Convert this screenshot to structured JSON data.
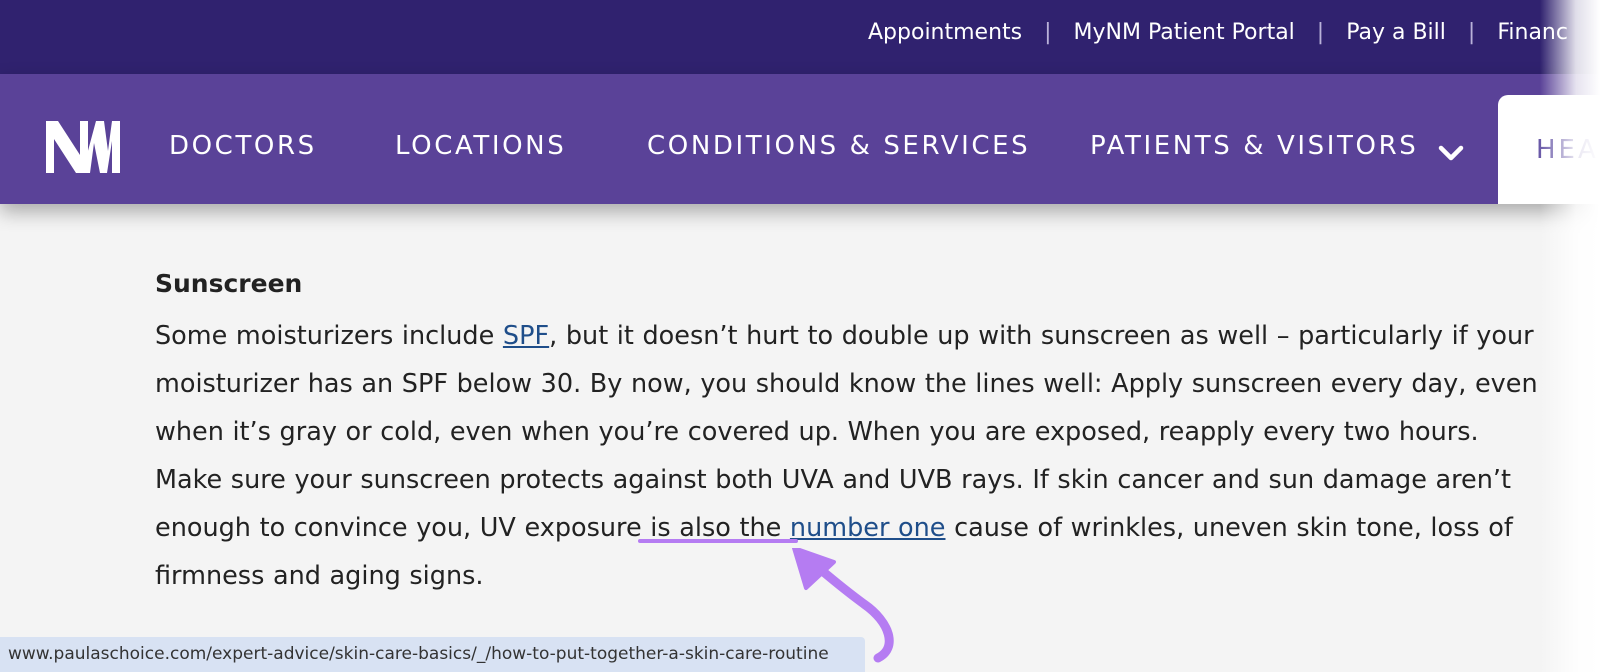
{
  "top_links": [
    "Appointments",
    "MyNM Patient Portal",
    "Pay a Bill",
    "Financ"
  ],
  "top_separator": "|",
  "logo_text": "NM",
  "nav": {
    "items": [
      "DOCTORS",
      "LOCATIONS",
      "CONDITIONS & SERVICES",
      "PATIENTS & VISITORS"
    ],
    "button_label": "HEA"
  },
  "article": {
    "heading": "Sunscreen",
    "p_1": "Some moisturizers include ",
    "link_spf": "SPF",
    "p_2": ", but it doesn’t hurt to double up with sunscreen as well – particularly if your moisturizer has an SPF below 30. By now, you should know the lines well: Apply sunscreen every day, even when it’s gray or cold, even when you’re covered up. When you are exposed, reapply every two hours. Make sure your sunscreen protects against both UVA and UVB rays. If skin cancer and sun damage aren’t enough to convince you, UV exposure is also the ",
    "link_number_one": "number one",
    "p_3": " cause of wrinkles, uneven skin tone, loss of firmness and aging signs."
  },
  "status_url": "www.paulaschoice.com/expert-advice/skin-care-basics/_/how-to-put-together-a-skin-care-routine",
  "colors": {
    "top_bar": "#30226f",
    "nav_bar": "#5a4298",
    "link": "#1f4e8a",
    "highlight": "#b57cf2",
    "status_bar": "#d8e2f3"
  },
  "icons": {
    "dropdown": "chevron-down-icon",
    "annotation": "curved-arrow-icon"
  }
}
